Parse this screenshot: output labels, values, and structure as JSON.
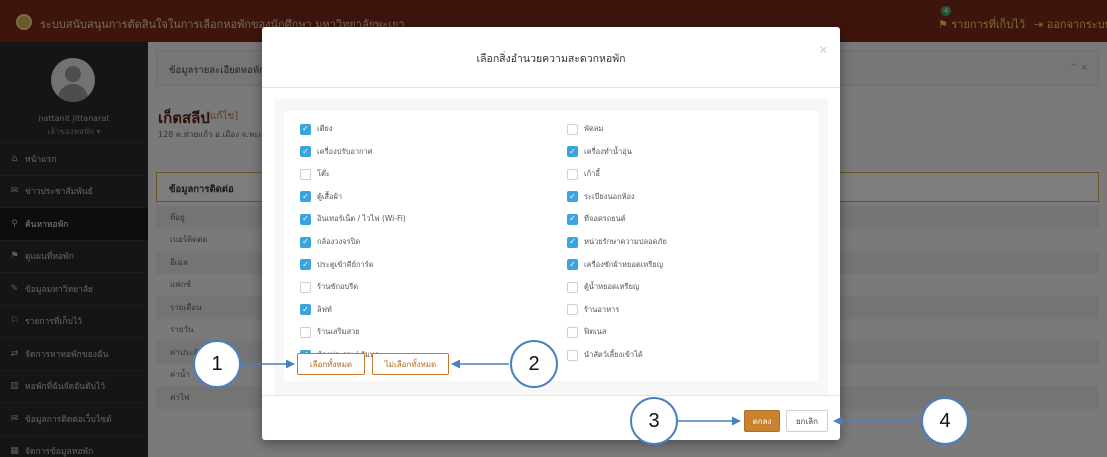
{
  "topbar": {
    "app_title": "ระบบสนับสนุนการตัดสินใจในการเลือกหอพักของนักศึกษา มหาวิทยาลัยพะเยา",
    "saved_label": "รายการที่เก็บไว้",
    "saved_count": "4",
    "logout_label": "ออกจากระบบ"
  },
  "sidebar": {
    "user_name": "nattanit jittanarat",
    "user_role": "เจ้าของหอพัก ▾",
    "items": [
      {
        "icon": "home-icon",
        "glyph": "⌂",
        "label": "หน้าแรก",
        "active": false
      },
      {
        "icon": "megaphone-icon",
        "glyph": "✉",
        "label": "ข่าวประชาสัมพันธ์",
        "active": false
      },
      {
        "icon": "search-icon",
        "glyph": "⚲",
        "label": "ค้นหาหอพัก",
        "active": true
      },
      {
        "icon": "map-marker-icon",
        "glyph": "⚑",
        "label": "ดูแผนที่หอพัก",
        "active": false
      },
      {
        "icon": "graduation-cap-icon",
        "glyph": "✎",
        "label": "ข้อมูลมหาวิทยาลัย",
        "active": false
      },
      {
        "icon": "bookmark-icon",
        "glyph": "⚐",
        "label": "รายการที่เก็บไว้",
        "active": false
      },
      {
        "icon": "exchange-icon",
        "glyph": "⇄",
        "label": "จัดการหาหอพักของฉัน",
        "active": false
      },
      {
        "icon": "bar-chart-icon",
        "glyph": "▥",
        "label": "หอพักที่ฉันจัดอันดับไว้",
        "active": false
      },
      {
        "icon": "comment-icon",
        "glyph": "✉",
        "label": "ข้อมูลการติดต่อเว็บไซต์",
        "active": false
      },
      {
        "icon": "table-icon",
        "glyph": "▦",
        "label": "จัดการข้อมูลหอพัก",
        "active": false
      }
    ]
  },
  "content": {
    "panel_title": "ข้อมูลรายละเอียดหอพัก",
    "panel_controls": "^ ×",
    "dorm_name": "เก็ตสลีป",
    "dorm_edit": "[แก้ไข]",
    "dorm_address": "128 ต.ห่วยแก้ว อ.เมือง จ.พะเยา",
    "contact_title": "ข้อมูลการติดต่อ",
    "rows": [
      "ที่อยู่",
      "เบอร์ติดต่อ",
      "อีเมล",
      "แฟกซ์",
      "รายเดือน",
      "รายวัน",
      "ค่าประกัน",
      "ค่าน้ำ",
      "ค่าไฟ"
    ]
  },
  "modal": {
    "title": "เลือกสิ่งอำนวยความสะดวกหอพัก",
    "close": "×",
    "amenities": [
      {
        "label": "เตียง",
        "checked": true
      },
      {
        "label": "พัดลม",
        "checked": false
      },
      {
        "label": "เครื่องปรับอากาศ",
        "checked": true
      },
      {
        "label": "เครื่องทำน้ำอุ่น",
        "checked": true
      },
      {
        "label": "โต๊ะ",
        "checked": false
      },
      {
        "label": "เก้าอี้",
        "checked": false
      },
      {
        "label": "ตู้เสื้อผ้า",
        "checked": true
      },
      {
        "label": "ระเบียงนอกห้อง",
        "checked": true
      },
      {
        "label": "อินเทอร์เน็ต / ไวไฟ (Wi-Fi)",
        "checked": true
      },
      {
        "label": "ที่จอดรถยนต์",
        "checked": true
      },
      {
        "label": "กล้องวงจรปิด",
        "checked": true
      },
      {
        "label": "หน่วยรักษาความปลอดภัย",
        "checked": true
      },
      {
        "label": "ประตูเข้าคีย์การ์ด",
        "checked": true
      },
      {
        "label": "เครื่องซักผ้าหยอดเหรียญ",
        "checked": true
      },
      {
        "label": "ร้านซักอบรีด",
        "checked": false
      },
      {
        "label": "ตู้น้ำหยอดเหรียญ",
        "checked": false
      },
      {
        "label": "ลิฟท์",
        "checked": true
      },
      {
        "label": "ร้านอาหาร",
        "checked": false
      },
      {
        "label": "ร้านเสริมสวย",
        "checked": false
      },
      {
        "label": "ฟิตเนส",
        "checked": false
      },
      {
        "label": "ห้องประชุม / สัมนา",
        "checked": true
      },
      {
        "label": "นำสัตว์เลี้ยงเข้าได้",
        "checked": false
      }
    ],
    "select_all_label": "เลือกทั้งหมด",
    "deselect_all_label": "ไม่เลือกทั้งหมด",
    "ok_label": "ตกลง",
    "cancel_label": "ยกเลิก"
  },
  "callouts": [
    "1",
    "2",
    "3",
    "4"
  ],
  "colors": {
    "topbar": "#7a2b18",
    "accent": "#c9822e",
    "checkbox_on": "#3aa4dc",
    "callout_border": "#4a7fc1"
  }
}
